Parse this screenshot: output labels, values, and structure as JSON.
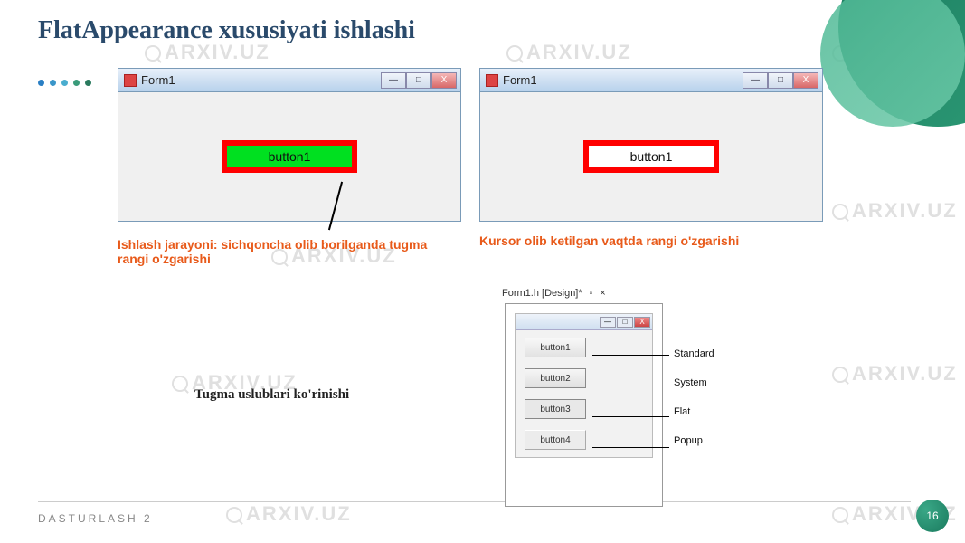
{
  "title": "FlatAppearance xususiyati ishlashi",
  "watermark_text": "ARXIV.UZ",
  "window1": {
    "title": "Form1",
    "button_label": "button1",
    "caption": "Ishlash jarayoni: sichqoncha olib borilganda tugma rangi o'zgarishi"
  },
  "window2": {
    "title": "Form1",
    "button_label": "button1",
    "caption": "Kursor olib ketilgan vaqtda rangi o'zgarishi"
  },
  "styles_caption": "Tugma uslublari ko'rinishi",
  "designer_tab": "Form1.h [Design]*",
  "designer_pin": "▫",
  "designer_close": "×",
  "style_buttons": {
    "b1": "button1",
    "b2": "button2",
    "b3": "button3",
    "b4": "button4"
  },
  "style_labels": {
    "l1": "Standard",
    "l2": "System",
    "l3": "Flat",
    "l4": "Popup"
  },
  "win_buttons": {
    "minimize": "—",
    "maximize": "□",
    "close": "X"
  },
  "footer": "DASTURLASH 2",
  "page_number": "16"
}
